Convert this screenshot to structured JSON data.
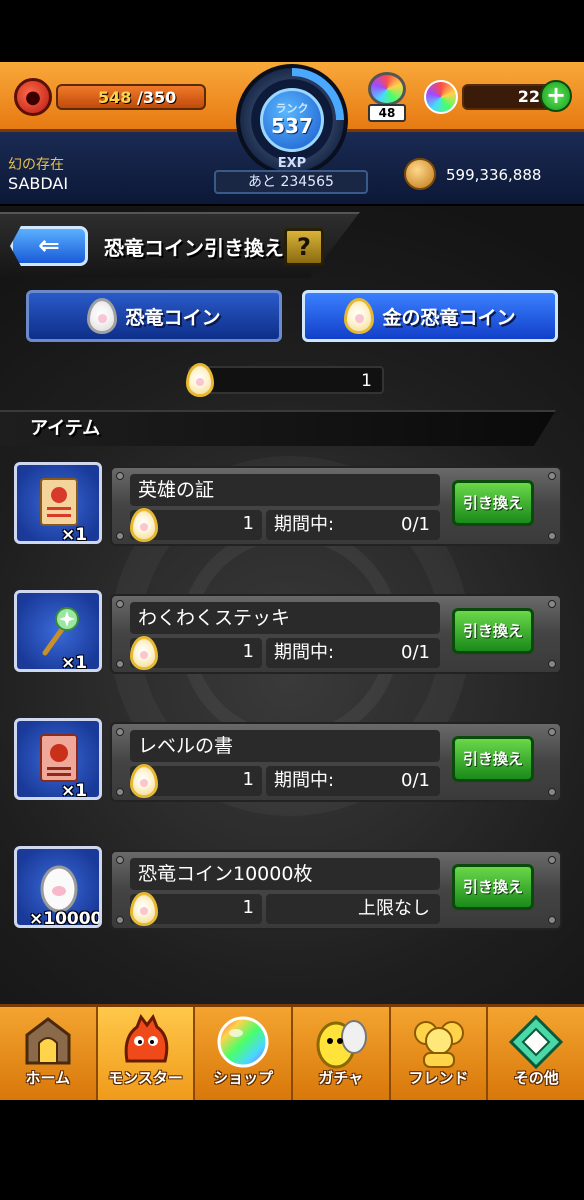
{
  "header": {
    "stamina_current": "548",
    "stamina_max": "/350",
    "stamina_fraction": 1.0,
    "rank_label": "ランク",
    "rank_value": "537",
    "exp_label": "EXP",
    "exp_remaining": "あと 234565",
    "orb_stock": "48",
    "orbs": "22",
    "player_title": "幻の存在",
    "player_name": "SABDAI",
    "gold": "599,336,888"
  },
  "page": {
    "title": "恐竜コイン引き換え",
    "help": "?",
    "back_icon": "back-arrow-icon"
  },
  "tabs": [
    {
      "label": "恐竜コイン"
    },
    {
      "label": "金の恐竜コイン"
    }
  ],
  "balance": "1",
  "section_title": "アイテム",
  "items": [
    {
      "name": "英雄の証",
      "qty": "×1",
      "price": "1",
      "limit_label": "期間中:",
      "limit_value": "0/1",
      "button": "引き換え",
      "icon": "scroll-icon"
    },
    {
      "name": "わくわくステッキ",
      "qty": "×1",
      "price": "1",
      "limit_label": "期間中:",
      "limit_value": "0/1",
      "button": "引き換え",
      "icon": "wand-icon"
    },
    {
      "name": "レベルの書",
      "qty": "×1",
      "price": "1",
      "limit_label": "期間中:",
      "limit_value": "0/1",
      "button": "引き換え",
      "icon": "book-icon"
    },
    {
      "name": "恐竜コイン10000枚",
      "qty": "×10000",
      "price": "1",
      "limit_label": "",
      "limit_value": "上限なし",
      "button": "引き換え",
      "icon": "coin-egg-icon"
    }
  ],
  "nav": [
    {
      "label": "ホーム",
      "icon": "home-icon"
    },
    {
      "label": "モンスター",
      "icon": "monster-icon"
    },
    {
      "label": "ショップ",
      "icon": "shop-orb-icon"
    },
    {
      "label": "ガチャ",
      "icon": "gacha-egg-icon"
    },
    {
      "label": "フレンド",
      "icon": "friend-icon"
    },
    {
      "label": "その他",
      "icon": "other-icon"
    }
  ],
  "colors": {
    "header_orange": "#f9a83a",
    "exchange_green": "#1a8a1a",
    "tab_blue": "#1240c8"
  }
}
